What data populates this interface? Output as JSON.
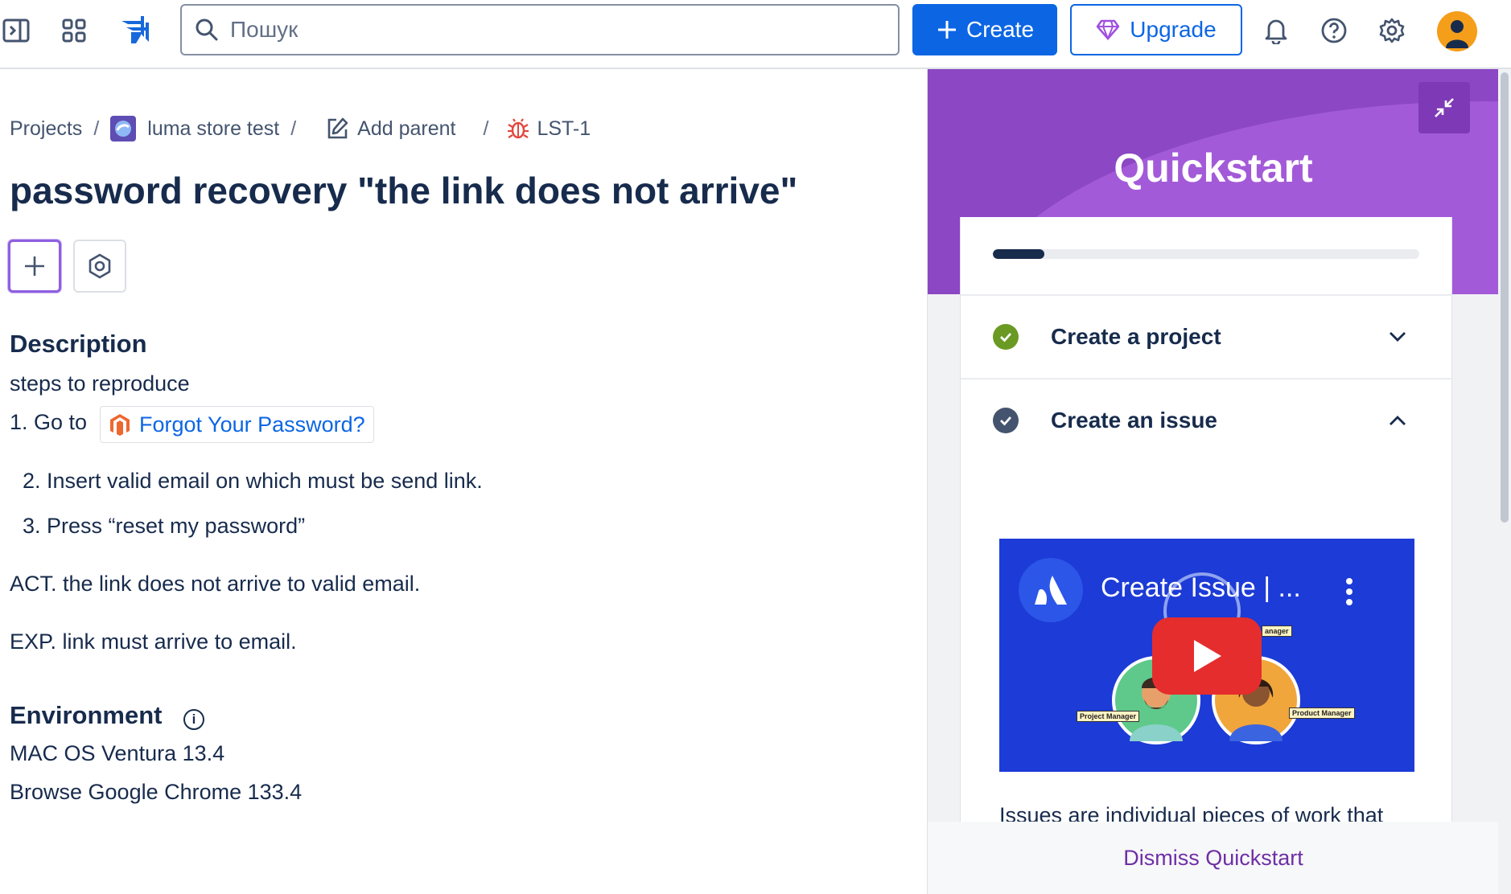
{
  "topbar": {
    "search_placeholder": "Пошук",
    "create_label": "Create",
    "upgrade_label": "Upgrade"
  },
  "breadcrumb": {
    "projects": "Projects",
    "project_name": "luma store test",
    "add_parent": "Add parent",
    "issue_key": "LST-1",
    "separator": "/"
  },
  "issue": {
    "title": "password recovery \"the link does not arrive\"",
    "description_heading": "Description",
    "description": {
      "line1": "steps to reproduce",
      "step1_prefix": "1. Go to",
      "step1_link": "Forgot Your Password?",
      "step2": "2. Insert  valid email on which must be send link.",
      "step3": "3. Press “reset my password”",
      "actual": "ACT. the link does not arrive to valid email.",
      "expected": "EXP.  link must arrive to email."
    },
    "environment_heading": "Environment",
    "environment": {
      "os": "MAC OS  Ventura 13.4",
      "browser": "Browse Google Chrome 133.4"
    }
  },
  "quickstart": {
    "title": "Quickstart",
    "progress": 0.12,
    "items": [
      {
        "label": "Create a project",
        "done": true,
        "expanded": false
      },
      {
        "label": "Create an issue",
        "done": true,
        "expanded": true
      }
    ],
    "video": {
      "title": "Create Issue | ...",
      "tag_left": "Project Manager",
      "tag_right": "Product Manager",
      "tag_top": "anager"
    },
    "issue_description": "Issues are individual pieces of work that you assign to teammates.",
    "dismiss_label": "Dismiss Quickstart"
  },
  "colors": {
    "brand_blue": "#0c66e4",
    "quickstart_purple": "#8b47c4",
    "done_green": "#6a9a23",
    "bug_red": "#e2483d"
  }
}
